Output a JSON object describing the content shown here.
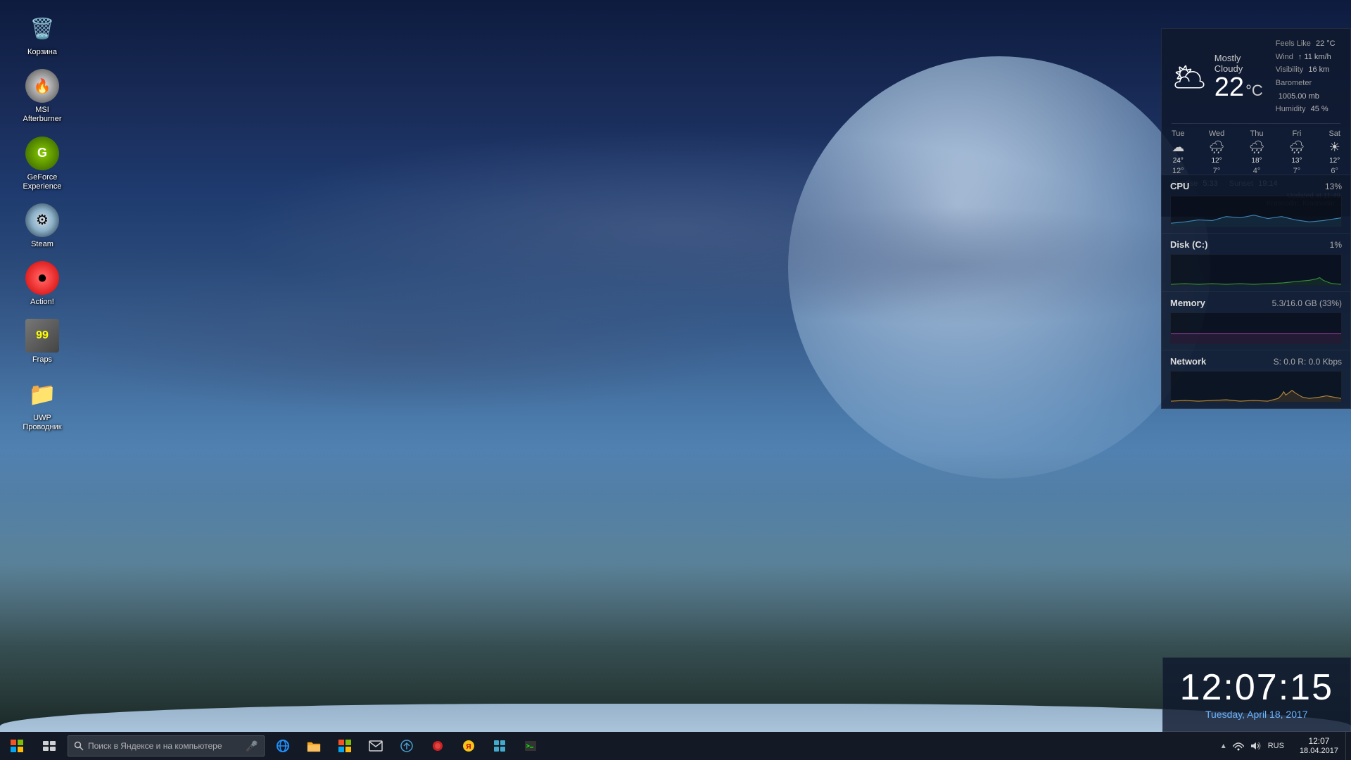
{
  "desktop": {
    "background": "space landscape with moon",
    "icons": [
      {
        "id": "recycle-bin",
        "label": "Корзина",
        "icon_type": "recycle",
        "icon_char": "🗑"
      },
      {
        "id": "msi-afterburner",
        "label": "MSI\nAfterburner",
        "icon_type": "msi",
        "icon_char": "🔥"
      },
      {
        "id": "geforce-experience",
        "label": "GeForce\nExperience",
        "icon_type": "geforce",
        "icon_char": "G"
      },
      {
        "id": "steam",
        "label": "Steam",
        "icon_type": "steam",
        "icon_char": "⚙"
      },
      {
        "id": "action",
        "label": "Action!",
        "icon_type": "action",
        "icon_char": "⏺"
      },
      {
        "id": "fraps",
        "label": "Fraps",
        "icon_type": "fraps",
        "icon_char": "99"
      },
      {
        "id": "uwp-explorer",
        "label": "UWP\nПроводник",
        "icon_type": "folder",
        "icon_char": "📁"
      }
    ]
  },
  "weather": {
    "condition": "Mostly Cloudy",
    "temperature": "22",
    "unit": "°C",
    "feels_like_label": "Feels Like",
    "feels_like_value": "22 °C",
    "wind_label": "Wind",
    "wind_value": "↑ 11 km/h",
    "visibility_label": "Visibility",
    "visibility_value": "16 km",
    "barometer_label": "Barometer",
    "barometer_value": "1005.00 mb",
    "humidity_label": "Humidity",
    "humidity_value": "45 %",
    "forecast": [
      {
        "day": "Tue",
        "icon": "☁",
        "high": "24°",
        "low": "12°"
      },
      {
        "day": "Wed",
        "icon": "🌧",
        "high": "12°",
        "low": "7°"
      },
      {
        "day": "Thu",
        "icon": "🌧",
        "high": "18°",
        "low": "4°"
      },
      {
        "day": "Fri",
        "icon": "🌧",
        "high": "13°",
        "low": "7°"
      },
      {
        "day": "Sat",
        "icon": "☀",
        "high": "12°",
        "low": "6°"
      }
    ],
    "sunrise_label": "Sunrise",
    "sunrise_value": "5:33",
    "sunset_label": "Sunset",
    "sunset_value": "19:14",
    "updated_label": "Updated at 11:49",
    "location": "Krasnodar, Krasnodar..."
  },
  "sysmon": {
    "cpu_label": "CPU",
    "cpu_value": "13%",
    "disk_label": "Disk (C:)",
    "disk_value": "1%",
    "memory_label": "Memory",
    "memory_value": "5.3/16.0 GB (33%)",
    "network_label": "Network",
    "network_value": "S: 0.0  R: 0.0 Kbps"
  },
  "clock": {
    "time": "12:07:15",
    "date": "Tuesday, April 18, 2017"
  },
  "taskbar": {
    "search_placeholder": "Поиск в Яндексе и на компьютере",
    "time": "12:07",
    "date": "18.04.2017",
    "language": "RUS"
  }
}
